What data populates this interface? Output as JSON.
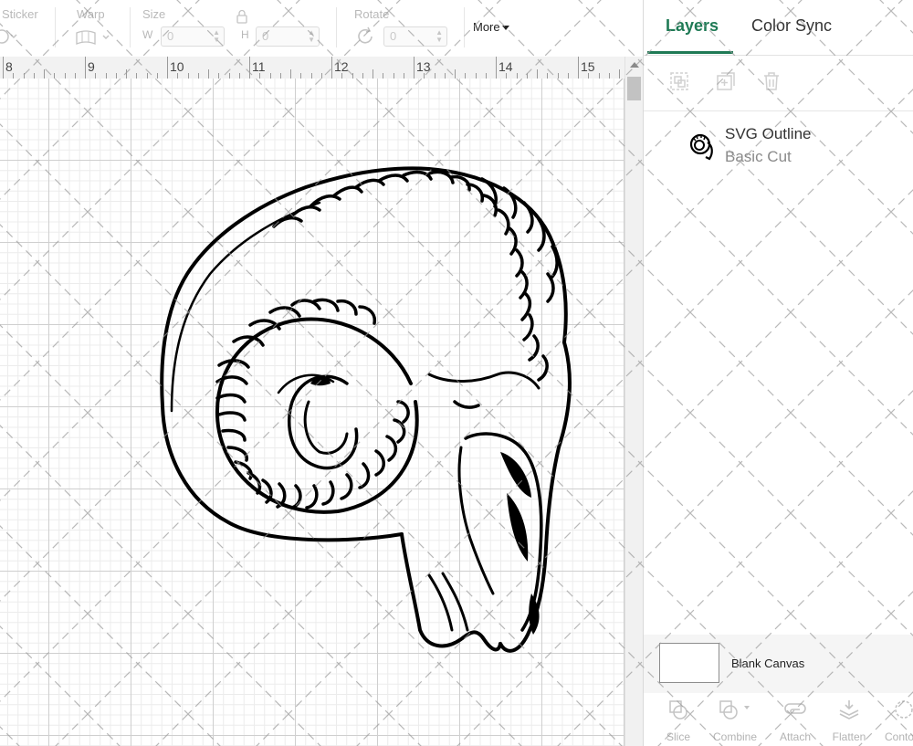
{
  "toolbar": {
    "sticker_label": "Sticker",
    "warp_label": "Warp",
    "size_label": "Size",
    "width_short": "W",
    "width_value": "0",
    "height_short": "H",
    "height_value": "0",
    "rotate_label": "Rotate",
    "rotate_value": "0",
    "more_label": "More"
  },
  "ruler": {
    "labels": [
      "8",
      "9",
      "10",
      "11",
      "12",
      "13",
      "14",
      "15"
    ]
  },
  "panel": {
    "tabs": [
      {
        "label": "Layers",
        "active": true
      },
      {
        "label": "Color Sync",
        "active": false
      }
    ],
    "layer_actions": [
      "group-icon",
      "duplicate-icon",
      "delete-icon"
    ],
    "layer": {
      "name": "SVG Outline",
      "operation": "Basic Cut"
    },
    "blank_canvas_label": "Blank Canvas",
    "bottom_tools": [
      {
        "label": "Slice",
        "icon": "slice-icon"
      },
      {
        "label": "Combine",
        "icon": "combine-icon"
      },
      {
        "label": "Attach",
        "icon": "attach-icon"
      },
      {
        "label": "Flatten",
        "icon": "flatten-icon"
      },
      {
        "label": "Conto",
        "icon": "contour-icon"
      }
    ]
  },
  "colors": {
    "accent": "#1f7a55",
    "grid_major": "#cfcfcf",
    "grid_minor": "#ececec"
  }
}
